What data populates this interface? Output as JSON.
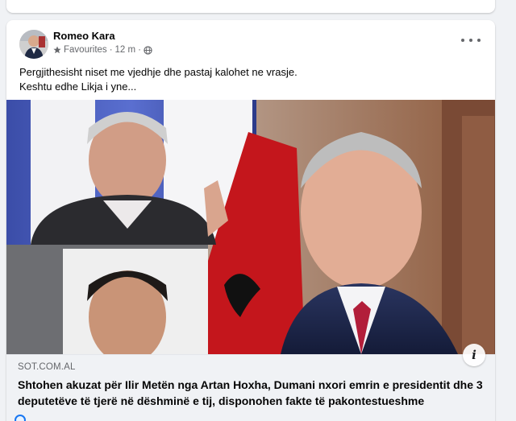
{
  "post": {
    "author": "Romeo Kara",
    "audience": "Favourites",
    "separator": "·",
    "time": "12 m",
    "separator2": "·",
    "text_line1": "Pergjithesisht niset me vjedhje dhe pastaj kalohet ne vrasje.",
    "text_line2": "Keshtu edhe Likja i yne..."
  },
  "link": {
    "domain": "SOT.COM.AL",
    "headline": "Shtohen akuzat për Ilir Metën nga Artan Hoxha, Dumani nxori emrin e presidentit dhe 3 deputetëve të tjerë në dëshminë e tij, disponohen fakte të pakontestueshme",
    "info_glyph": "i"
  },
  "icons": {
    "audience": "star-icon",
    "privacy": "globe-icon",
    "more": "more-options-icon",
    "info": "info-icon"
  },
  "colors": {
    "page_bg": "#f0f2f5",
    "card_bg": "#ffffff",
    "text_primary": "#050505",
    "text_secondary": "#65676b",
    "accent": "#1877f2"
  }
}
